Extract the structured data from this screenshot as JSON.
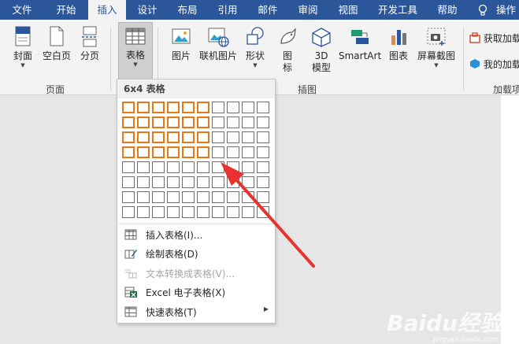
{
  "tabs": [
    {
      "label": "文件"
    },
    {
      "label": "开始"
    },
    {
      "label": "插入",
      "active": true
    },
    {
      "label": "设计"
    },
    {
      "label": "布局"
    },
    {
      "label": "引用"
    },
    {
      "label": "邮件"
    },
    {
      "label": "审阅"
    },
    {
      "label": "视图"
    },
    {
      "label": "开发工具"
    },
    {
      "label": "帮助"
    },
    {
      "label": "操作"
    }
  ],
  "ribbon": {
    "pages": {
      "cover": "封面",
      "blank": "空白页",
      "break": "分页",
      "group": "页面"
    },
    "tables": {
      "table": "表格"
    },
    "illustrations": {
      "picture": "图片",
      "online_picture": "联机图片",
      "shapes": "形状",
      "icons_l1": "图",
      "icons_l2": "标",
      "model_l1": "3D",
      "model_l2": "模型",
      "smartart": "SmartArt",
      "chart": "图表",
      "screenshot": "屏幕截图",
      "group": "插图"
    },
    "addins": {
      "get": "获取加载",
      "my": "我的加载",
      "group": "加载项"
    }
  },
  "table_menu": {
    "header": "6x4 表格",
    "grid_cols": 10,
    "grid_rows": 8,
    "selected_cols": 6,
    "selected_rows": 4,
    "items": [
      {
        "label": "插入表格(I)...",
        "enabled": true,
        "icon": "insert-table-icon"
      },
      {
        "label": "绘制表格(D)",
        "enabled": true,
        "icon": "draw-table-icon"
      },
      {
        "label": "文本转换成表格(V)...",
        "enabled": false,
        "icon": "convert-text-icon"
      },
      {
        "label": "Excel 电子表格(X)",
        "enabled": true,
        "icon": "excel-icon"
      },
      {
        "label": "快速表格(T)",
        "enabled": true,
        "icon": "quick-table-icon"
      }
    ]
  },
  "annotation_color": "#e8322f",
  "tab_bar_color": "#2b579a",
  "highlight_color": "#e77817",
  "watermark": {
    "brand": "Baidu经验",
    "url": "jingyan.baidu.com"
  }
}
